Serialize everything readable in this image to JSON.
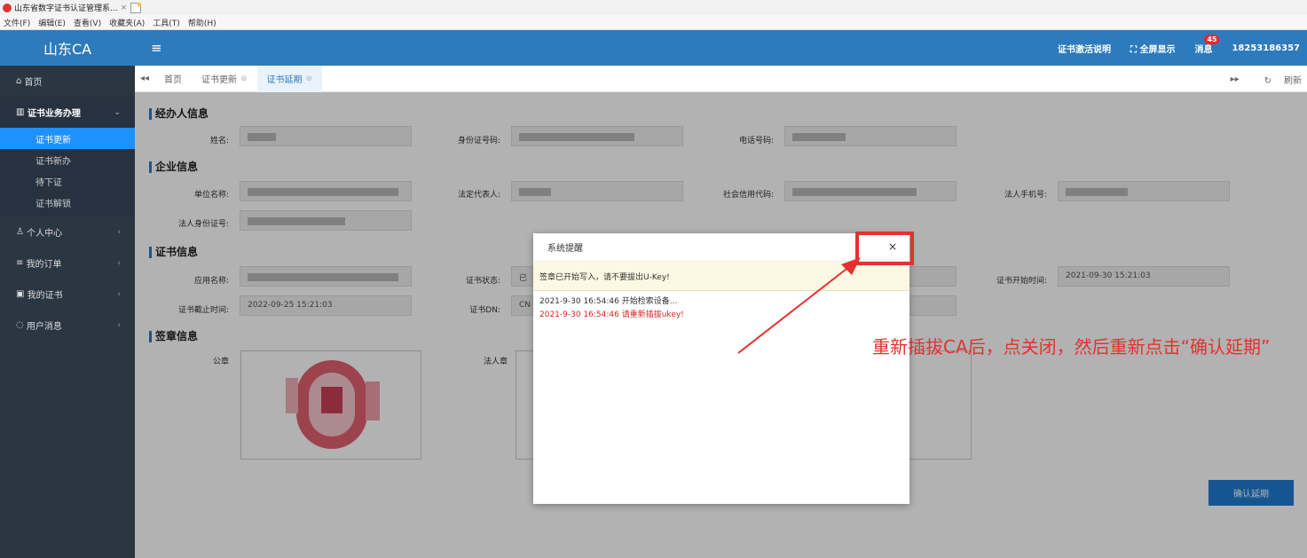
{
  "browser": {
    "tab_title": "山东省数字证书认证管理系...",
    "tab_close": "×"
  },
  "menubar": [
    "文件(F)",
    "编辑(E)",
    "查看(V)",
    "收藏夹(A)",
    "工具(T)",
    "帮助(H)"
  ],
  "header": {
    "logo": "山东CA",
    "menu_toggle": "≡",
    "activation_guide": "证书激活说明",
    "fullscreen": "全屏显示",
    "messages": "消息",
    "message_count": "45",
    "phone": "18253186357"
  },
  "sidebar": {
    "home": "首页",
    "cert_business": "证书业务办理",
    "sub_items": [
      "证书更新",
      "证书新办",
      "待下证",
      "证书解锁"
    ],
    "active_sub": 0,
    "personal_center": "个人中心",
    "my_orders": "我的订单",
    "my_certs": "我的证书",
    "user_messages": "用户消息"
  },
  "page_tabs": {
    "tabs": [
      "首页",
      "证书更新",
      "证书延期"
    ],
    "refresh": "刷新"
  },
  "form": {
    "agent_section": "经办人信息",
    "name_label": "姓名:",
    "id_label": "身份证号码:",
    "phone_label": "电话号码:",
    "company_section": "企业信息",
    "company_name_label": "单位名称:",
    "legal_rep_label": "法定代表人:",
    "credit_code_label": "社会信用代码:",
    "legal_phone_label": "法人手机号:",
    "legal_id_label": "法人身份证号:",
    "cert_section": "证书信息",
    "app_name_label": "应用名称:",
    "cert_status_label": "证书状态:",
    "cert_status_value": "已",
    "cert_start_label": "证书开始时间:",
    "cert_start_value": "2021-09-30 15:21:03",
    "cert_end_label": "证书截止时间:",
    "cert_end_value": "2022-09-25 15:21:03",
    "cert_dn_label": "证书DN:",
    "cert_dn_value": "CN",
    "seal_section": "签章信息",
    "public_seal_label": "公章",
    "legal_seal_label": "法人章",
    "confirm_button": "确认延期"
  },
  "modal": {
    "title": "系统提醒",
    "close": "×",
    "warning": "签章已开始写入，请不要拔出U-Key!",
    "logs": [
      {
        "text": "2021-9-30 16:54:46  开始检索设备...",
        "error": false
      },
      {
        "text": "2021-9-30 16:54:46  请重新插拔ukey!",
        "error": true
      }
    ]
  },
  "annotation": "重新插拔CA后，点关闭，然后重新点击“确认延期”",
  "colors": {
    "primary": "#2d7bbd",
    "sidebar": "#2b3643",
    "active": "#1e90ff",
    "annotation": "#e53030"
  }
}
